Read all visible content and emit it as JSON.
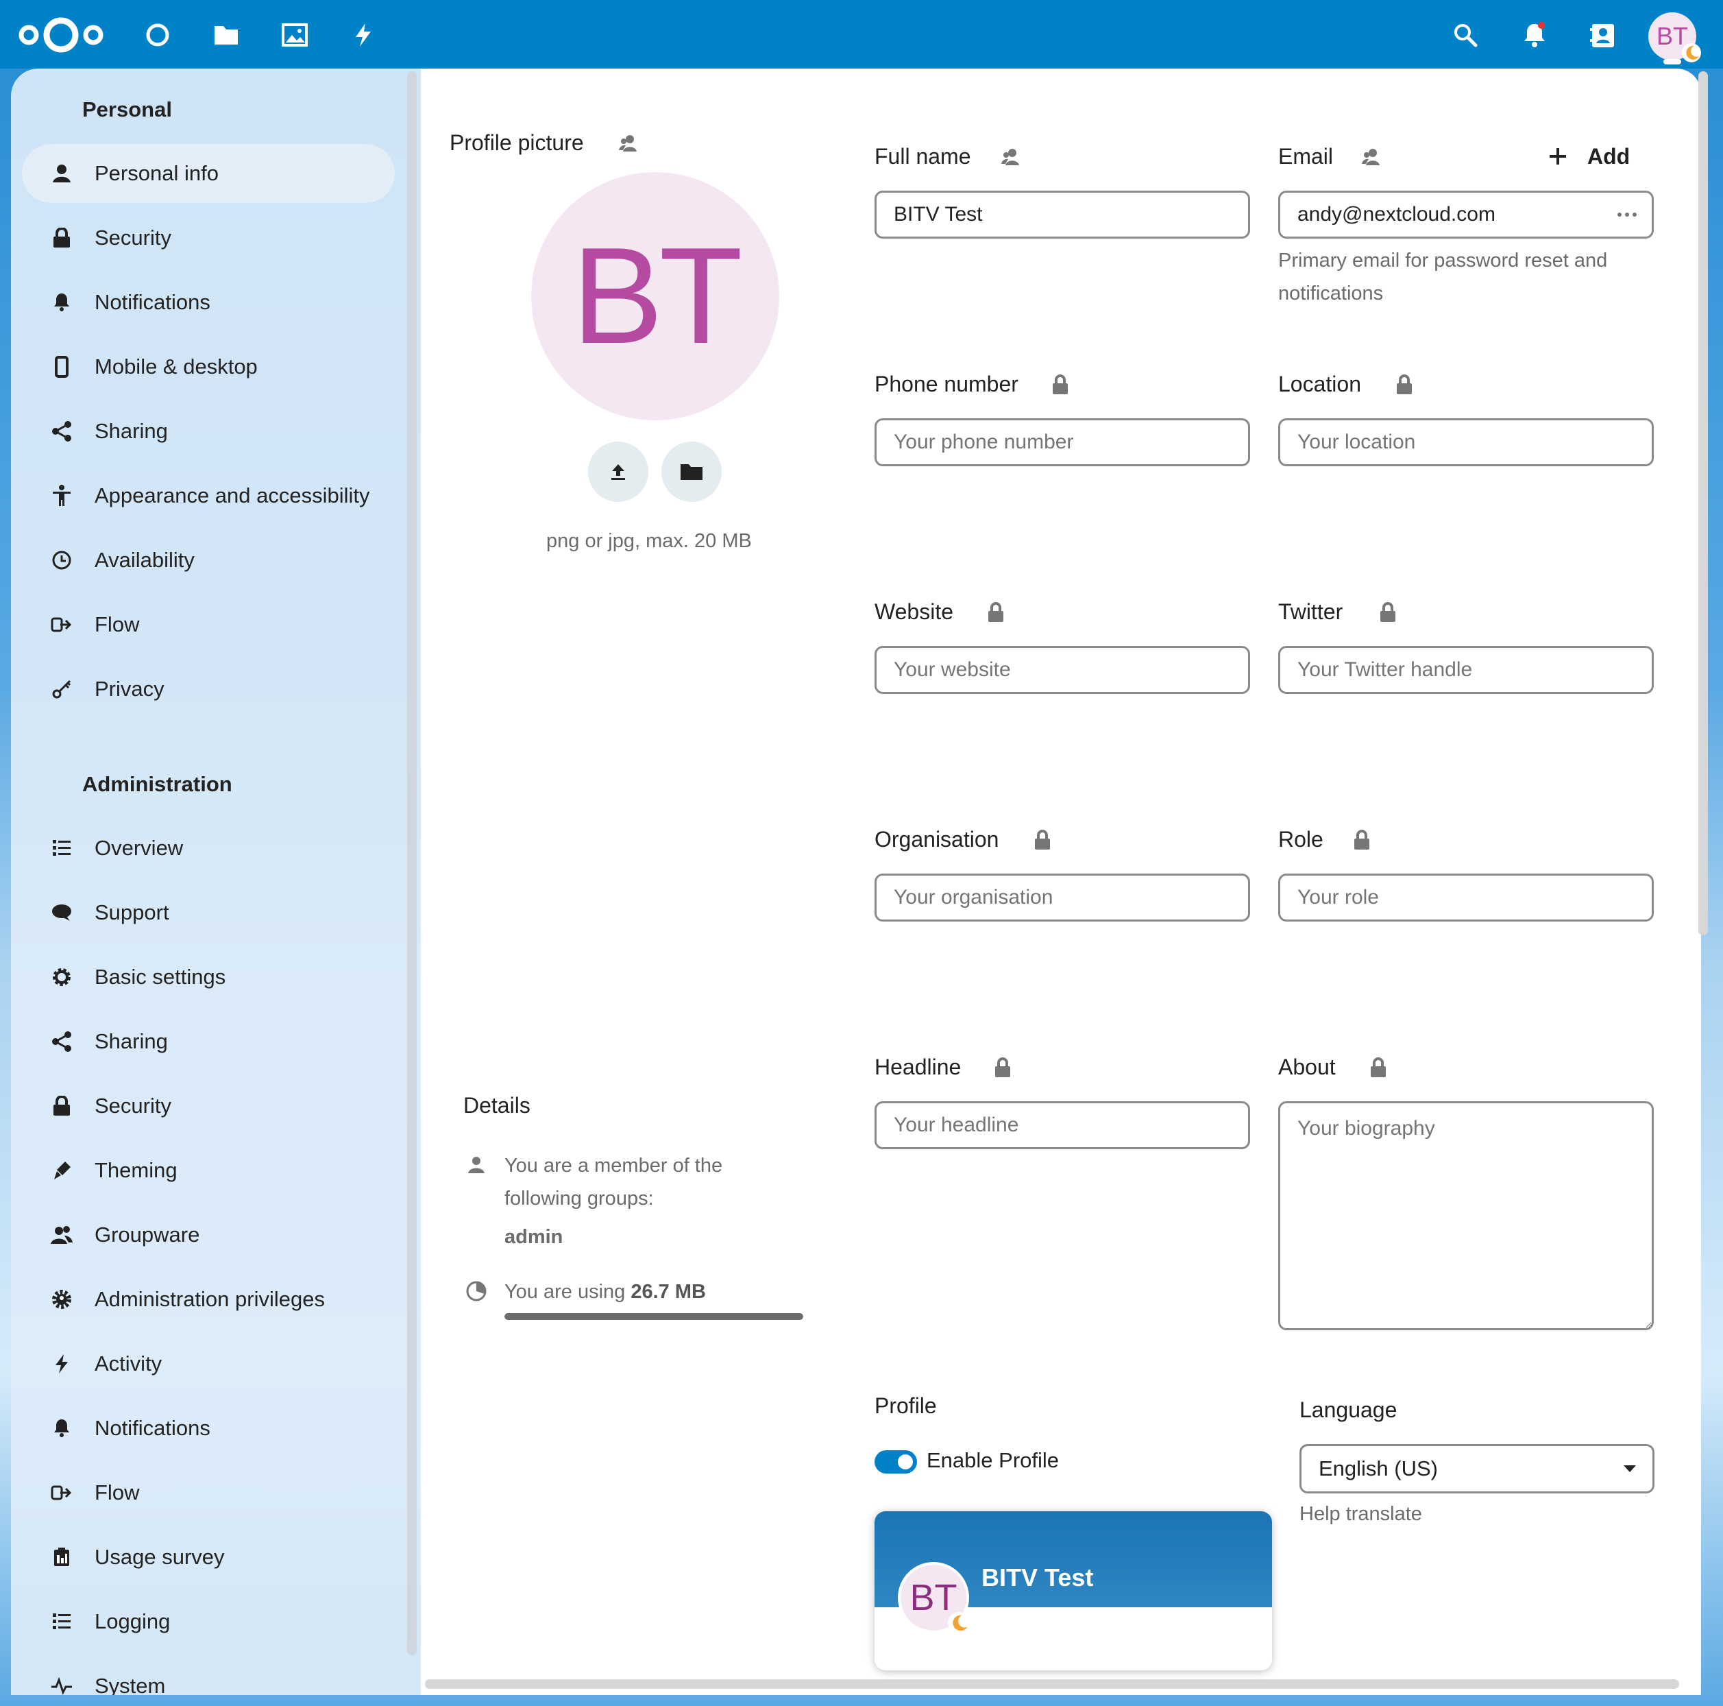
{
  "colors": {
    "brand": "#0082c9",
    "avatar_bg": "#f4e7f2",
    "avatar_text": "#b44ba1"
  },
  "user": {
    "initials": "BT",
    "display_name": "BITV Test"
  },
  "header": {
    "apps": [
      "dashboard-icon",
      "files-icon",
      "photos-icon",
      "activity-icon"
    ],
    "right": [
      "search-icon",
      "notifications-icon",
      "contacts-icon"
    ]
  },
  "sidebar": {
    "personal_title": "Personal",
    "personal_items": [
      {
        "label": "Personal info",
        "icon": "user-icon"
      },
      {
        "label": "Security",
        "icon": "lock-icon"
      },
      {
        "label": "Notifications",
        "icon": "bell-icon"
      },
      {
        "label": "Mobile & desktop",
        "icon": "phone-icon"
      },
      {
        "label": "Sharing",
        "icon": "share-icon"
      },
      {
        "label": "Appearance and accessibility",
        "icon": "accessibility-icon"
      },
      {
        "label": "Availability",
        "icon": "clock-icon"
      },
      {
        "label": "Flow",
        "icon": "flow-icon"
      },
      {
        "label": "Privacy",
        "icon": "key-icon"
      }
    ],
    "admin_title": "Administration",
    "admin_items": [
      {
        "label": "Overview",
        "icon": "list-icon"
      },
      {
        "label": "Support",
        "icon": "chat-icon"
      },
      {
        "label": "Basic settings",
        "icon": "gear-icon"
      },
      {
        "label": "Sharing",
        "icon": "share-icon"
      },
      {
        "label": "Security",
        "icon": "lock-icon"
      },
      {
        "label": "Theming",
        "icon": "brush-icon"
      },
      {
        "label": "Groupware",
        "icon": "group-icon"
      },
      {
        "label": "Administration privileges",
        "icon": "admin-gear-icon"
      },
      {
        "label": "Activity",
        "icon": "lightning-icon"
      },
      {
        "label": "Notifications",
        "icon": "bell-icon"
      },
      {
        "label": "Flow",
        "icon": "flow-icon"
      },
      {
        "label": "Usage survey",
        "icon": "survey-icon"
      },
      {
        "label": "Logging",
        "icon": "list-icon"
      },
      {
        "label": "System",
        "icon": "pulse-icon"
      }
    ]
  },
  "profile_picture": {
    "label": "Profile picture",
    "hint": "png or jpg, max. 20 MB"
  },
  "fields": {
    "full_name": {
      "label": "Full name",
      "value": "BITV Test"
    },
    "email": {
      "label": "Email",
      "add_label": "Add",
      "value": "andy@nextcloud.com",
      "helper": "Primary email for password reset and notifications"
    },
    "phone": {
      "label": "Phone number",
      "placeholder": "Your phone number"
    },
    "location": {
      "label": "Location",
      "placeholder": "Your location"
    },
    "website": {
      "label": "Website",
      "placeholder": "Your website"
    },
    "twitter": {
      "label": "Twitter",
      "placeholder": "Your Twitter handle"
    },
    "organisation": {
      "label": "Organisation",
      "placeholder": "Your organisation"
    },
    "role": {
      "label": "Role",
      "placeholder": "Your role"
    },
    "headline": {
      "label": "Headline",
      "placeholder": "Your headline"
    },
    "about": {
      "label": "About",
      "placeholder": "Your biography"
    }
  },
  "details": {
    "title": "Details",
    "groups_text_1": "You are a member of the",
    "groups_text_2": "following groups:",
    "groups": "admin",
    "usage_prefix": "You are using",
    "usage_value": "26.7 MB",
    "quota_fraction": 1.0
  },
  "profile": {
    "title": "Profile",
    "toggle_label": "Enable Profile",
    "enabled": true
  },
  "language": {
    "title": "Language",
    "selected": "English (US)",
    "help_link": "Help translate"
  }
}
